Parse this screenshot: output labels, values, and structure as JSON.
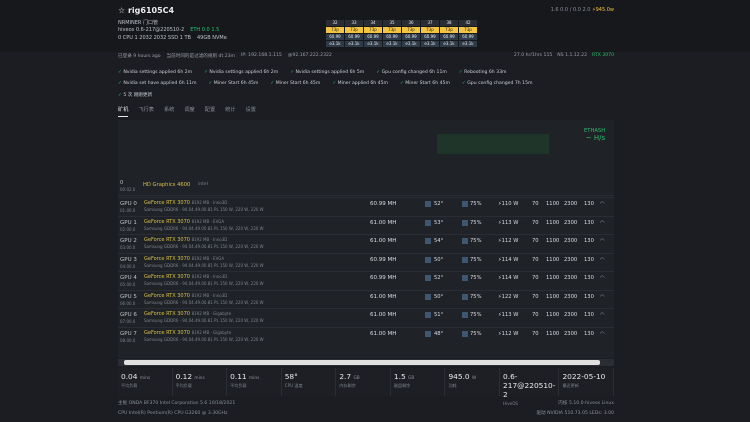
{
  "header": {
    "title": "rig6105C4",
    "top_right": "1.6  0.0 / 0.0   2.0",
    "power": "945.0w"
  },
  "info": {
    "group": "NRMINER 门口管",
    "os_line": "hiveos 0.6-217@220510-2",
    "fs_line": "0  CPU 1  2032  2032  SSD 1 TB",
    "storage": "49GB  NVMe",
    "status_line": "ETH  0.0 1.5"
  },
  "gpu_mini": {
    "labels": [
      "32",
      "33",
      "34",
      "35",
      "36",
      "37",
      "38",
      "42"
    ],
    "temps": [
      "73p",
      "73p",
      "73p",
      "73p",
      "73p",
      "73p",
      "73p",
      "73p"
    ],
    "rates": [
      "60.99",
      "60.99",
      "60.99",
      "60.99",
      "60.99",
      "60.99",
      "60.99",
      "60.99"
    ],
    "extras": [
      "e3.1k",
      "e3.1k",
      "e3.1k",
      "e3.1k",
      "e3.1k",
      "e3.1k",
      "e3.1k",
      "e3.1k"
    ]
  },
  "meta_line": {
    "a": "已登录 9 hours ago",
    "b": "当前时间的是过滤的规则 dt  23m",
    "c": "IP: 192.168.1.115",
    "d": "@92.167.222.2322",
    "e": "27.0 hr/1hrs 115",
    "f": "NS  1.1.12.22",
    "g": "RTX 3070"
  },
  "logs": {
    "r1": [
      "Nvidia settings applied 6h 2m",
      "Nvidia settings applied 6h 2m",
      "Nvidia settings applied 6h 5m",
      "Gpu config changed 6h 11m",
      "Rebooting 6h 33m"
    ],
    "r2": [
      "Nvidia set  have applied 6h 11m",
      "Miner Start 6h 45m",
      "Miner Start 6h 45m",
      "Miner applied 6h 45m",
      "Miner Start 6h 45m",
      "Gpu config changed 7h 15m"
    ],
    "r3": "5 次 刚刚更新"
  },
  "tabs": [
    "矿机",
    "飞行表",
    "系统",
    "调度",
    "配置",
    "统计",
    "设置"
  ],
  "panel": {
    "eth_label": "ETHASH",
    "eth_value": "~ H/s",
    "col_heads": [
      "▣",
      "▣",
      "▣",
      "▣",
      "▣"
    ]
  },
  "igpu": {
    "id": "0",
    "sub": "00:02.0",
    "name": "HD Graphics 4600",
    "tag": "intel"
  },
  "gpus": [
    {
      "id": "GPU 0",
      "bus": "01:00.0",
      "name": "GeForce RTX 3070",
      "brand": "8192 MB · Inno3D",
      "mem": "Samsung GDDR6 · 94.04.49.00.81  PL 150 W, 220 W, 220 W",
      "rate": "60.99 MH",
      "temp": "52°",
      "fan": "75%",
      "pw": "110 W",
      "c1": "70",
      "c2": "1100",
      "c3": "2300",
      "c4": "130"
    },
    {
      "id": "GPU 1",
      "bus": "02:00.0",
      "name": "GeForce RTX 3070",
      "brand": "8192 MB · EVGA",
      "mem": "Samsung GDDR6 · 94.04.49.00.81  PL 150 W, 220 W, 220 W",
      "rate": "61.00 MH",
      "temp": "53°",
      "fan": "75%",
      "pw": "113 W",
      "c1": "70",
      "c2": "1100",
      "c3": "2300",
      "c4": "130"
    },
    {
      "id": "GPU 2",
      "bus": "03:00.0",
      "name": "GeForce RTX 3070",
      "brand": "8192 MB · Inno3D",
      "mem": "Samsung GDDR6 · 94.04.49.00.81  PL 150 W, 220 W, 220 W",
      "rate": "61.00 MH",
      "temp": "54°",
      "fan": "75%",
      "pw": "112 W",
      "c1": "70",
      "c2": "1100",
      "c3": "2300",
      "c4": "130"
    },
    {
      "id": "GPU 3",
      "bus": "04:00.0",
      "name": "GeForce RTX 3070",
      "brand": "8192 MB · EVGA",
      "mem": "Samsung GDDR6 · 94.04.49.00.81  PL 150 W, 220 W, 220 W",
      "rate": "60.99 MH",
      "temp": "50°",
      "fan": "75%",
      "pw": "114 W",
      "c1": "70",
      "c2": "1100",
      "c3": "2300",
      "c4": "130"
    },
    {
      "id": "GPU 4",
      "bus": "05:00.0",
      "name": "GeForce RTX 3070",
      "brand": "8192 MB · Inno3D",
      "mem": "Samsung GDDR6 · 94.04.49.00.81  PL 150 W, 220 W, 220 W",
      "rate": "60.99 MH",
      "temp": "52°",
      "fan": "75%",
      "pw": "114 W",
      "c1": "70",
      "c2": "1100",
      "c3": "2300",
      "c4": "130"
    },
    {
      "id": "GPU 5",
      "bus": "06:00.0",
      "name": "GeForce RTX 3070",
      "brand": "8192 MB · Inno3D",
      "mem": "Samsung GDDR6 · 94.04.49.00.81  PL 150 W, 220 W, 220 W",
      "rate": "61.00 MH",
      "temp": "50°",
      "fan": "75%",
      "pw": "122 W",
      "c1": "70",
      "c2": "1100",
      "c3": "2300",
      "c4": "130"
    },
    {
      "id": "GPU 6",
      "bus": "07:00.0",
      "name": "GeForce RTX 3070",
      "brand": "8192 MB · Gigabyte",
      "mem": "Samsung GDDR6 · 94.04.49.00.81  PL 150 W, 220 W, 220 W",
      "rate": "61.00 MH",
      "temp": "51°",
      "fan": "75%",
      "pw": "113 W",
      "c1": "70",
      "c2": "1100",
      "c3": "2300",
      "c4": "130"
    },
    {
      "id": "GPU 7",
      "bus": "08:00.0",
      "name": "GeForce RTX 3070",
      "brand": "8192 MB · Gigabyte",
      "mem": "Samsung GDDR6 · 94.04.49.00.81  PL 150 W, 220 W, 220 W",
      "rate": "61.00 MH",
      "temp": "48°",
      "fan": "75%",
      "pw": "112 W",
      "c1": "70",
      "c2": "1100",
      "c3": "2300",
      "c4": "130"
    }
  ],
  "stats": [
    {
      "v": "0.04",
      "u": "mins",
      "l": "平均负载"
    },
    {
      "v": "0.12",
      "u": "mins",
      "l": "平均负载"
    },
    {
      "v": "0.11",
      "u": "mins",
      "l": "平均负载"
    },
    {
      "v": "58°",
      "u": "",
      "l": "CPU 温度"
    },
    {
      "v": "2.7",
      "u": "GB",
      "l": "内存剩余"
    },
    {
      "v": "1.5",
      "u": "GB",
      "l": "磁盘剩余"
    },
    {
      "v": "945.0",
      "u": "W",
      "l": "功耗"
    },
    {
      "v": "0.6-217@220510-2",
      "u": "",
      "l": "HiveOS"
    },
    {
      "v": "2022-05-10",
      "u": "",
      "l": "最近更新"
    }
  ],
  "footer": {
    "l1": "主板  ONDA BF370 Intel Corporation 5.6  10/18/2021",
    "r1": "内核  5.10.0-hiveos  Linux",
    "l2": "CPU  Intel(R) Pentium(R) CPU G3260 @ 3.30GHz",
    "r2": "驱动  NVIDIA 510.73.05  LEDs: 3.00"
  },
  "colors": {
    "accent_yellow": "#f4c542",
    "green": "#2ebd6b"
  }
}
